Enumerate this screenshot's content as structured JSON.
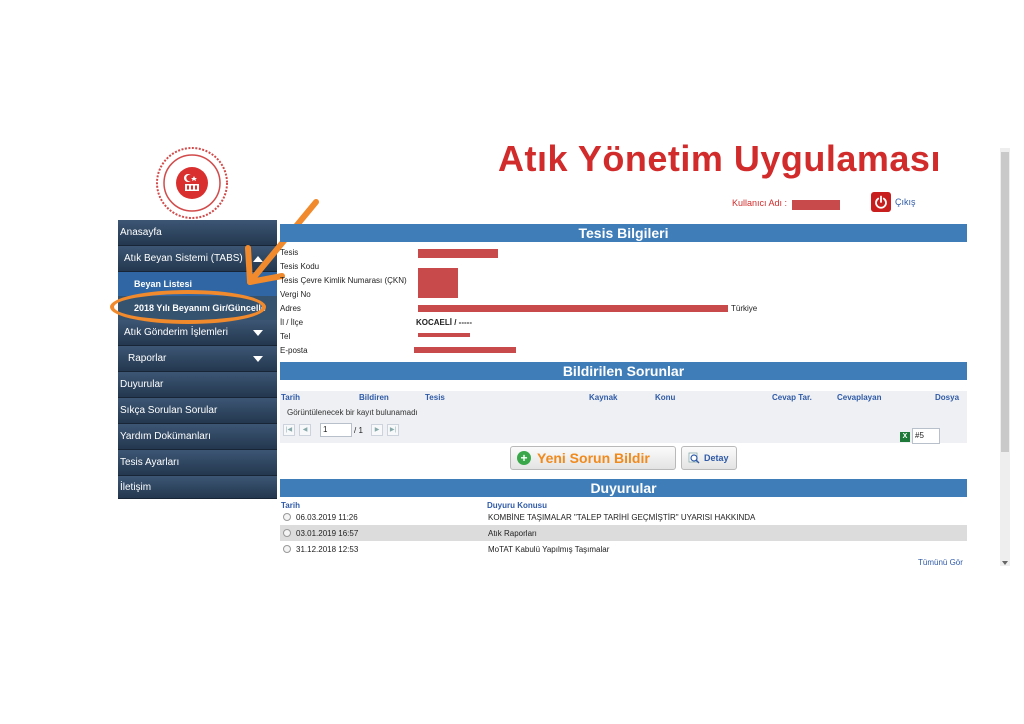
{
  "header": {
    "title": "Atık Yönetim Uygulaması",
    "user_label": "Kullanıcı Adı :",
    "logout_label": "Çıkış"
  },
  "sidebar": {
    "items": [
      {
        "label": "Anasayfa"
      },
      {
        "label": "Atık Beyan Sistemi (TABS)"
      },
      {
        "label": "Beyan Listesi"
      },
      {
        "label": "2018 Yılı Beyanını Gir/Güncelle"
      },
      {
        "label": "Atık Gönderim İşlemleri"
      },
      {
        "label": "Raporlar"
      },
      {
        "label": "Duyurular"
      },
      {
        "label": "Sıkça Sorulan Sorular"
      },
      {
        "label": "Yardım Dokümanları"
      },
      {
        "label": "Tesis Ayarları"
      },
      {
        "label": "İletişim"
      }
    ]
  },
  "tesis": {
    "title": "Tesis Bilgileri",
    "labels": {
      "tesis": "Tesis",
      "kod": "Tesis Kodu",
      "ckn": "Tesis Çevre Kimlik Numarası (ÇKN)",
      "vergi": "Vergi No",
      "adres": "Adres",
      "il": "İl / İlçe",
      "tel": "Tel",
      "eposta": "E-posta"
    },
    "country": "Türkiye",
    "il_value": "KOCAELİ / -----"
  },
  "sorunlar": {
    "title": "Bildirilen Sorunlar",
    "columns": [
      "Tarih",
      "Bildiren",
      "Tesis",
      "Kaynak",
      "Konu",
      "Cevap Tar.",
      "Cevaplayan",
      "Dosya"
    ],
    "empty_message": "Görüntülenecek bir kayıt bulunamadı",
    "page": "1",
    "page_total": "/ 1",
    "page_size": "5",
    "page_size_prefix": "#",
    "new_button": "Yeni Sorun Bildir",
    "detail_button": "Detay"
  },
  "duyurular": {
    "title": "Duyurular",
    "columns": [
      "Tarih",
      "Duyuru Konusu"
    ],
    "rows": [
      {
        "date": "06.03.2019 11:26",
        "subject": "KOMBİNE TAŞIMALAR \"TALEP TARİHİ GEÇMİŞTİR\" UYARISI HAKKINDA"
      },
      {
        "date": "03.01.2019 16:57",
        "subject": "Atık Raporları"
      },
      {
        "date": "31.12.2018 12:53",
        "subject": "MoTAT Kabulü Yapılmış Taşımalar"
      }
    ],
    "see_all": "Tümünü Gör"
  },
  "colors": {
    "accent": "#3f7db8",
    "title_red": "#d12b2b",
    "annotation_orange": "#f08a2c"
  }
}
